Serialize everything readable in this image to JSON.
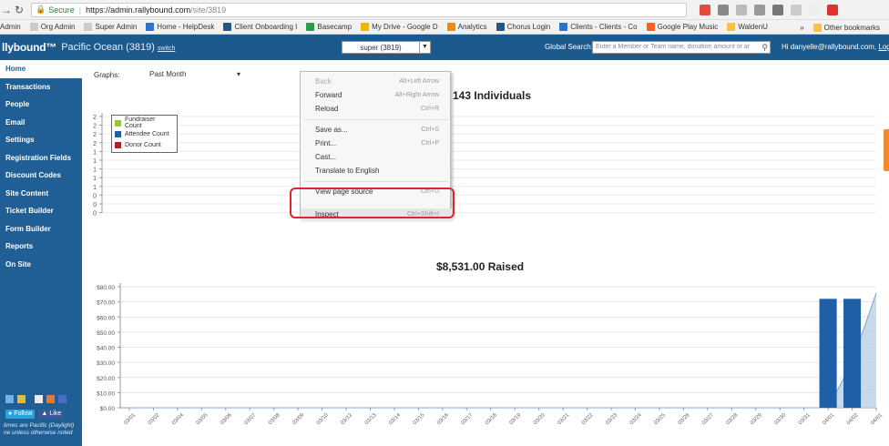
{
  "browser": {
    "url": {
      "secure_label": "Secure",
      "host": "https://admin.rallybound.com",
      "path": "/site/3819"
    },
    "bookmarks": [
      {
        "label": "Admin",
        "color": "#ffffff"
      },
      {
        "label": "Org Admin",
        "color": "#cccccc"
      },
      {
        "label": "Super Admin",
        "color": "#cccccc"
      },
      {
        "label": "Home - HelpDesk",
        "color": "#2a73c9"
      },
      {
        "label": "Client Onboarding I",
        "color": "#1c5a8e"
      },
      {
        "label": "Basecamp",
        "color": "#2e9b4a"
      },
      {
        "label": "My Drive - Google D",
        "color": "#f4b400"
      },
      {
        "label": "Analytics",
        "color": "#f28b00"
      },
      {
        "label": "Chorus Login",
        "color": "#1c5a8e"
      },
      {
        "label": "Clients - Clients - Co",
        "color": "#2a73c9"
      },
      {
        "label": "Google Play Music",
        "color": "#f26522"
      },
      {
        "label": "WaldenU",
        "color": "#f6c343"
      }
    ],
    "bookmarks_overflow": "»",
    "other_bookmarks": "Other bookmarks"
  },
  "app": {
    "logo": "llybound™",
    "org_name": "Pacific Ocean (3819)",
    "switch_label": "switch",
    "site_select": "super (3819)",
    "global_search_label": "Global Search:",
    "global_search_placeholder": "Enter a Member or Team name, donation amount or ar",
    "greeting": "Hi danyelle@rallybound.com,",
    "logout": "Logo"
  },
  "sidebar": {
    "items": [
      {
        "label": "Home",
        "active": true
      },
      {
        "label": "Transactions"
      },
      {
        "label": "People"
      },
      {
        "label": "Email"
      },
      {
        "label": "Settings"
      },
      {
        "label": "Registration Fields"
      },
      {
        "label": "Discount Codes"
      },
      {
        "label": "Site Content"
      },
      {
        "label": "Ticket Builder"
      },
      {
        "label": "Form Builder"
      },
      {
        "label": "Reports"
      },
      {
        "label": "On Site"
      }
    ],
    "follow_label": "Follow",
    "like_label": "Like",
    "timezone_note": "times are Pacific (Daylight) ne unless otherwise noted"
  },
  "main": {
    "graphs_label": "Graphs:",
    "range_select": "Past Month",
    "chart1_title": "143 Individuals",
    "chart2_title": "$8,531.00 Raised",
    "legend": [
      {
        "label": "Fundraiser Count",
        "color": "#9ac43c"
      },
      {
        "label": "Attendee Count",
        "color": "#1f5fa8"
      },
      {
        "label": "Donor Count",
        "color": "#b0202a"
      }
    ]
  },
  "chart_data": [
    {
      "type": "line",
      "title": "143 Individuals",
      "y_tick_labels": [
        "2",
        "2",
        "2",
        "2",
        "1",
        "1",
        "1",
        "1",
        "1",
        "0",
        "0",
        "0"
      ],
      "series": [
        {
          "name": "Fundraiser Count"
        },
        {
          "name": "Attendee Count"
        },
        {
          "name": "Donor Count"
        }
      ]
    },
    {
      "type": "bar",
      "title": "$8,531.00 Raised",
      "ylim": [
        0,
        80
      ],
      "y_ticks": [
        0,
        10,
        20,
        30,
        40,
        50,
        60,
        70,
        80
      ],
      "y_tick_labels": [
        "$0.00",
        "$10.00",
        "$20.00",
        "$30.00",
        "$40.00",
        "$50.00",
        "$60.00",
        "$70.00",
        "$80.00"
      ],
      "categories": [
        "03/01",
        "03/02",
        "03/04",
        "03/05",
        "03/06",
        "03/07",
        "03/08",
        "03/09",
        "03/10",
        "03/12",
        "03/13",
        "03/14",
        "03/15",
        "03/16",
        "03/17",
        "03/18",
        "03/19",
        "03/20",
        "03/21",
        "03/22",
        "03/23",
        "03/24",
        "03/25",
        "03/26",
        "03/27",
        "03/28",
        "03/29",
        "03/30",
        "03/31",
        "04/01",
        "04/02",
        "04/01"
      ],
      "values": [
        0,
        0,
        0,
        0,
        0,
        0,
        0,
        0,
        0,
        0,
        0,
        0,
        0,
        0,
        0,
        0,
        0,
        0,
        0,
        0,
        0,
        0,
        0,
        0,
        0,
        0,
        0,
        0,
        0,
        72,
        72,
        0
      ],
      "area_values": [
        0,
        0,
        0,
        0,
        0,
        0,
        0,
        0,
        0,
        0,
        0,
        0,
        0,
        0,
        0,
        0,
        0,
        0,
        0,
        0,
        0,
        0,
        0,
        0,
        0,
        0,
        0,
        0,
        0,
        0,
        30,
        76
      ],
      "bar_color": "#1f5fa8",
      "area_color": "#b9cfe6"
    }
  ],
  "context_menu": {
    "items": [
      {
        "label": "Back",
        "shortcut": "Alt+Left Arrow",
        "disabled": true
      },
      {
        "label": "Forward",
        "shortcut": "Alt+Right Arrow"
      },
      {
        "label": "Reload",
        "shortcut": "Ctrl+R"
      },
      {
        "sep": true
      },
      {
        "label": "Save as...",
        "shortcut": "Ctrl+S"
      },
      {
        "label": "Print...",
        "shortcut": "Ctrl+P"
      },
      {
        "label": "Cast..."
      },
      {
        "label": "Translate to English"
      },
      {
        "sep": true
      },
      {
        "label": "View page source",
        "shortcut": "Ctrl+U"
      },
      {
        "label": "Inspect",
        "shortcut": "Ctrl+Shift+I",
        "highlighted": true
      }
    ]
  }
}
